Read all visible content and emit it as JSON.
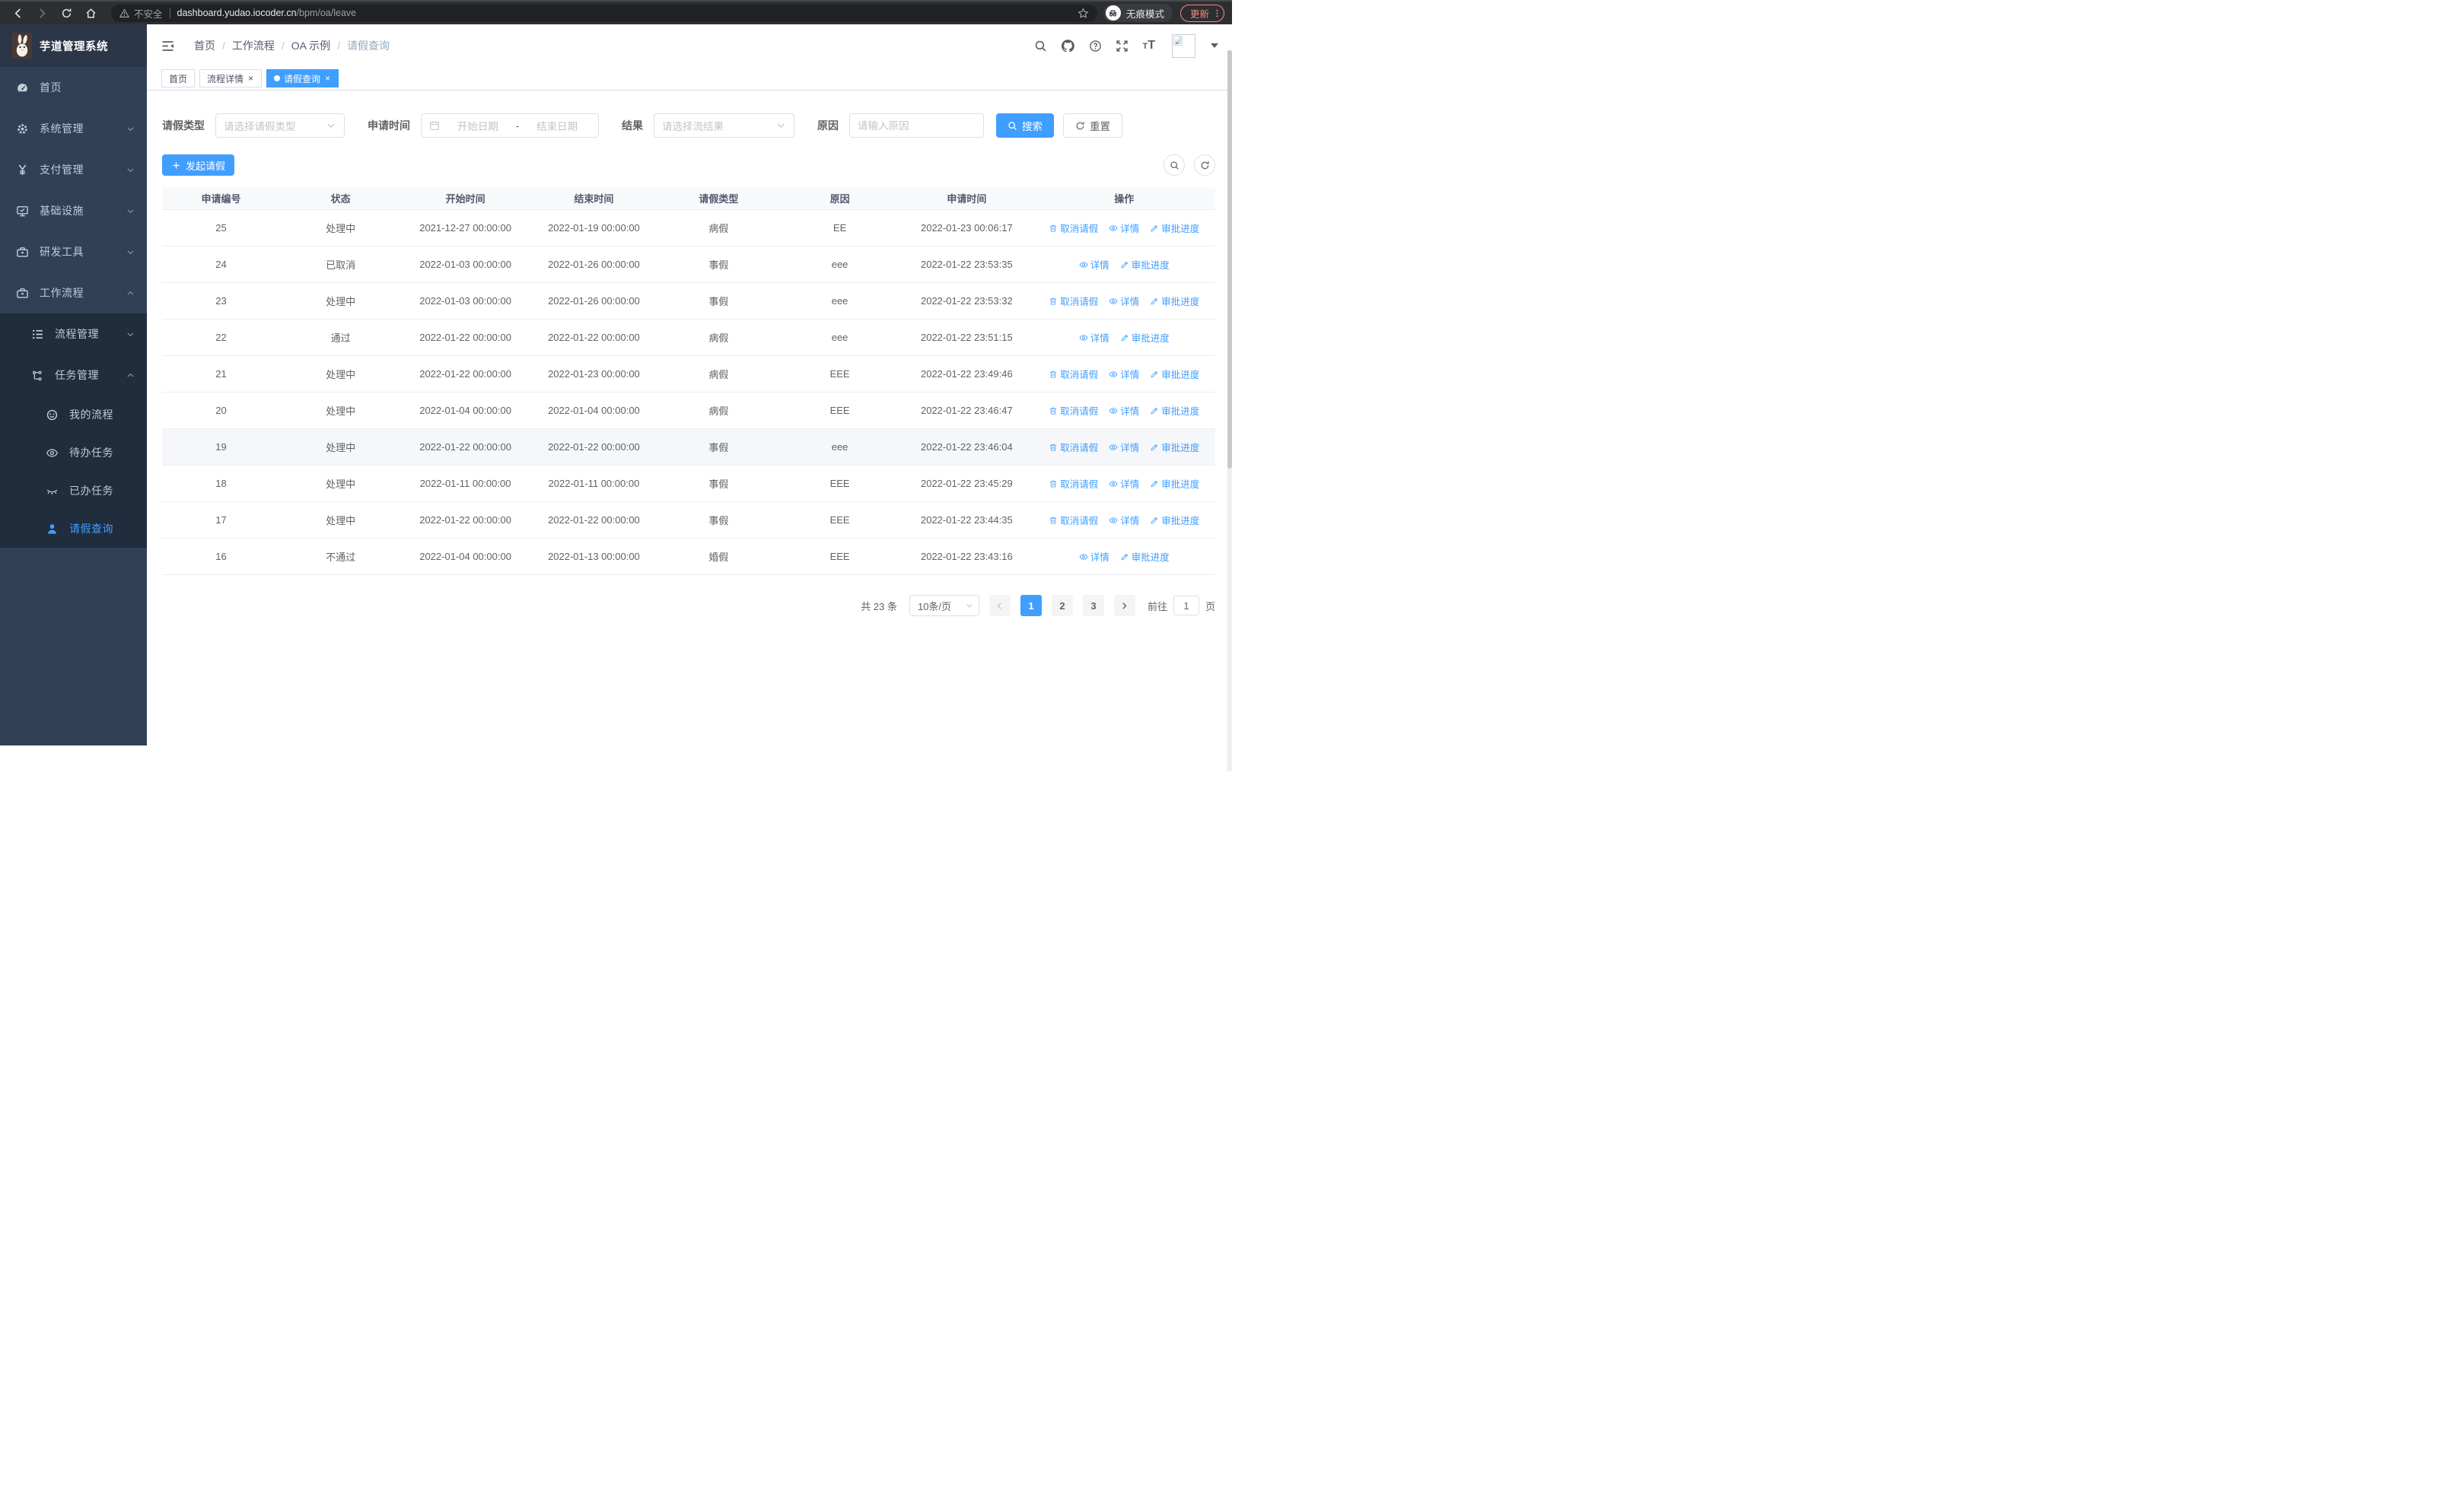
{
  "browser": {
    "security_warning": "不安全",
    "url_host": "dashboard.yudao.iocoder.cn",
    "url_path": "/bpm/oa/leave",
    "incognito_label": "无痕模式",
    "update_label": "更新"
  },
  "sidebar": {
    "title": "芋道管理系统",
    "menu": [
      {
        "name": "home",
        "label": "首页",
        "icon": "dashboard",
        "level": 1
      },
      {
        "name": "system-mgmt",
        "label": "系统管理",
        "icon": "gear",
        "level": 1,
        "chevron": "down"
      },
      {
        "name": "payment-mgmt",
        "label": "支付管理",
        "icon": "yen",
        "level": 1,
        "chevron": "down"
      },
      {
        "name": "infrastructure",
        "label": "基础设施",
        "icon": "monitor",
        "level": 1,
        "chevron": "down"
      },
      {
        "name": "dev-tools",
        "label": "研发工具",
        "icon": "toolbox",
        "level": 1,
        "chevron": "down"
      },
      {
        "name": "workflow",
        "label": "工作流程",
        "icon": "toolbox",
        "level": 1,
        "chevron": "up"
      }
    ],
    "submenu": [
      {
        "name": "process-mgmt",
        "label": "流程管理",
        "icon": "list",
        "indent": 1,
        "chevron": "down"
      },
      {
        "name": "task-mgmt",
        "label": "任务管理",
        "icon": "tree",
        "indent": 1,
        "chevron": "up"
      },
      {
        "name": "my-process",
        "label": "我的流程",
        "icon": "robot",
        "indent": 2
      },
      {
        "name": "todo-tasks",
        "label": "待办任务",
        "icon": "eye",
        "indent": 2
      },
      {
        "name": "done-tasks",
        "label": "已办任务",
        "icon": "eyeclosed",
        "indent": 2
      },
      {
        "name": "leave-query",
        "label": "请假查询",
        "icon": "user",
        "indent": 2,
        "active": true
      }
    ]
  },
  "header": {
    "breadcrumb": [
      "首页",
      "工作流程",
      "OA 示例",
      "请假查询"
    ]
  },
  "tabs": [
    {
      "name": "home",
      "label": "首页",
      "closable": false,
      "active": false
    },
    {
      "name": "process-detail",
      "label": "流程详情",
      "closable": true,
      "active": false
    },
    {
      "name": "leave-query",
      "label": "请假查询",
      "closable": true,
      "active": true
    }
  ],
  "filters": {
    "leave_type_label": "请假类型",
    "leave_type_placeholder": "请选择请假类型",
    "apply_time_label": "申请时间",
    "start_date_placeholder": "开始日期",
    "date_separator": "-",
    "end_date_placeholder": "结束日期",
    "result_label": "结果",
    "result_placeholder": "请选择流结果",
    "reason_label": "原因",
    "reason_placeholder": "请输入原因",
    "search_button": "搜索",
    "reset_button": "重置"
  },
  "toolbar": {
    "create_button": "发起请假"
  },
  "table": {
    "columns": [
      "申请编号",
      "状态",
      "开始时间",
      "结束时间",
      "请假类型",
      "原因",
      "申请时间",
      "操作"
    ],
    "action_labels": {
      "cancel": "取消请假",
      "detail": "详情",
      "progress": "审批进度"
    },
    "rows": [
      {
        "id": "25",
        "status": "处理中",
        "start": "2021-12-27 00:00:00",
        "end": "2022-01-19 00:00:00",
        "type": "病假",
        "reason": "EE",
        "applied": "2022-01-23 00:06:17",
        "actions": [
          "cancel",
          "detail",
          "progress"
        ],
        "highlight": false
      },
      {
        "id": "24",
        "status": "已取消",
        "start": "2022-01-03 00:00:00",
        "end": "2022-01-26 00:00:00",
        "type": "事假",
        "reason": "eee",
        "applied": "2022-01-22 23:53:35",
        "actions": [
          "detail",
          "progress"
        ],
        "highlight": false
      },
      {
        "id": "23",
        "status": "处理中",
        "start": "2022-01-03 00:00:00",
        "end": "2022-01-26 00:00:00",
        "type": "事假",
        "reason": "eee",
        "applied": "2022-01-22 23:53:32",
        "actions": [
          "cancel",
          "detail",
          "progress"
        ],
        "highlight": false
      },
      {
        "id": "22",
        "status": "通过",
        "start": "2022-01-22 00:00:00",
        "end": "2022-01-22 00:00:00",
        "type": "病假",
        "reason": "eee",
        "applied": "2022-01-22 23:51:15",
        "actions": [
          "detail",
          "progress"
        ],
        "highlight": false
      },
      {
        "id": "21",
        "status": "处理中",
        "start": "2022-01-22 00:00:00",
        "end": "2022-01-23 00:00:00",
        "type": "病假",
        "reason": "EEE",
        "applied": "2022-01-22 23:49:46",
        "actions": [
          "cancel",
          "detail",
          "progress"
        ],
        "highlight": false
      },
      {
        "id": "20",
        "status": "处理中",
        "start": "2022-01-04 00:00:00",
        "end": "2022-01-04 00:00:00",
        "type": "病假",
        "reason": "EEE",
        "applied": "2022-01-22 23:46:47",
        "actions": [
          "cancel",
          "detail",
          "progress"
        ],
        "highlight": false
      },
      {
        "id": "19",
        "status": "处理中",
        "start": "2022-01-22 00:00:00",
        "end": "2022-01-22 00:00:00",
        "type": "事假",
        "reason": "eee",
        "applied": "2022-01-22 23:46:04",
        "actions": [
          "cancel",
          "detail",
          "progress"
        ],
        "highlight": true
      },
      {
        "id": "18",
        "status": "处理中",
        "start": "2022-01-11 00:00:00",
        "end": "2022-01-11 00:00:00",
        "type": "事假",
        "reason": "EEE",
        "applied": "2022-01-22 23:45:29",
        "actions": [
          "cancel",
          "detail",
          "progress"
        ],
        "highlight": false
      },
      {
        "id": "17",
        "status": "处理中",
        "start": "2022-01-22 00:00:00",
        "end": "2022-01-22 00:00:00",
        "type": "事假",
        "reason": "EEE",
        "applied": "2022-01-22 23:44:35",
        "actions": [
          "cancel",
          "detail",
          "progress"
        ],
        "highlight": false
      },
      {
        "id": "16",
        "status": "不通过",
        "start": "2022-01-04 00:00:00",
        "end": "2022-01-13 00:00:00",
        "type": "婚假",
        "reason": "EEE",
        "applied": "2022-01-22 23:43:16",
        "actions": [
          "detail",
          "progress"
        ],
        "highlight": false
      }
    ]
  },
  "pagination": {
    "total_label": "共 23 条",
    "page_size": "10条/页",
    "pages": [
      "1",
      "2",
      "3"
    ],
    "active_page": "1",
    "prev_disabled": true,
    "goto_label": "前往",
    "goto_value": "1",
    "goto_suffix": "页"
  },
  "colors": {
    "accent": "#409eff",
    "sidebar_bg": "#304156",
    "submenu_bg": "#1f2d3d",
    "sidebar_text": "#bfcbd9",
    "active_tab_bg": "#409eff",
    "update_button": "#f28b82",
    "table_border": "#ebeef5",
    "header_row_bg": "#f8f9fb"
  }
}
